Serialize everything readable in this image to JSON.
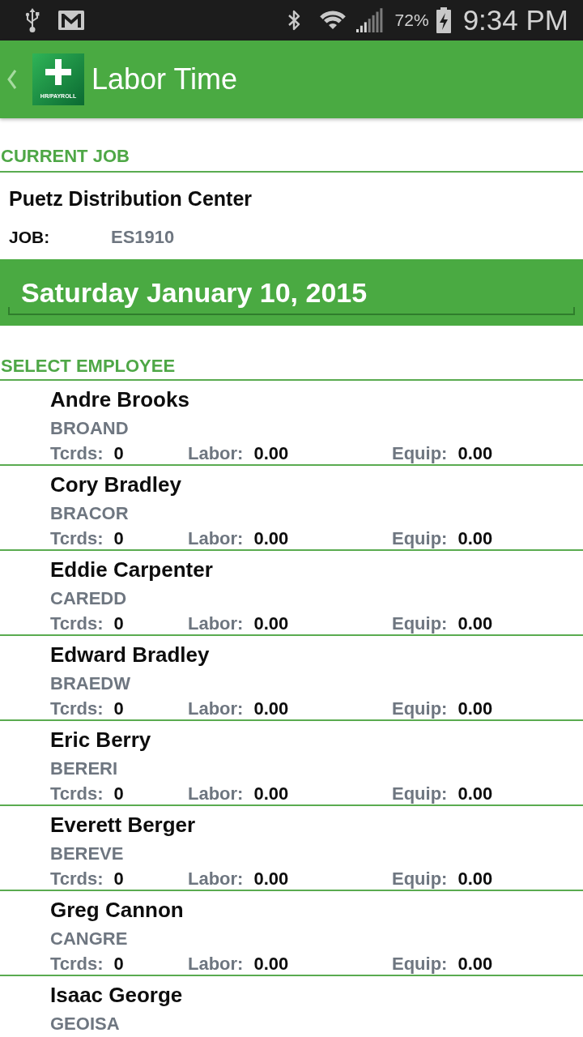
{
  "status_bar": {
    "battery": "72%",
    "time": "9:34 PM"
  },
  "app_bar": {
    "logo_caption": "HR/PAYROLL",
    "title": "Labor Time"
  },
  "current_job": {
    "heading": "CURRENT JOB",
    "name": "Puetz Distribution Center",
    "job_label": "JOB:",
    "job_number": "ES1910"
  },
  "date": "Saturday January 10, 2015",
  "employees": {
    "heading": "SELECT EMPLOYEE",
    "items": [
      {
        "name": "Andre Brooks",
        "code": "BROAND",
        "stats": [
          {
            "label": "Tcrds:",
            "value": "0"
          },
          {
            "label": "Labor:",
            "value": "0.00"
          },
          {
            "label": "Equip:",
            "value": "0.00"
          }
        ]
      },
      {
        "name": "Cory Bradley",
        "code": "BRACOR",
        "stats": [
          {
            "label": "Tcrds:",
            "value": "0"
          },
          {
            "label": "Labor:",
            "value": "0.00"
          },
          {
            "label": "Equip:",
            "value": "0.00"
          }
        ]
      },
      {
        "name": "Eddie Carpenter",
        "code": "CAREDD",
        "stats": [
          {
            "label": "Tcrds:",
            "value": "0"
          },
          {
            "label": "Labor:",
            "value": "0.00"
          },
          {
            "label": "Equip:",
            "value": "0.00"
          }
        ]
      },
      {
        "name": "Edward Bradley",
        "code": "BRAEDW",
        "stats": [
          {
            "label": "Tcrds:",
            "value": "0"
          },
          {
            "label": "Labor:",
            "value": "0.00"
          },
          {
            "label": "Equip:",
            "value": "0.00"
          }
        ]
      },
      {
        "name": "Eric Berry",
        "code": "BERERI",
        "stats": [
          {
            "label": "Tcrds:",
            "value": "0"
          },
          {
            "label": "Labor:",
            "value": "0.00"
          },
          {
            "label": "Equip:",
            "value": "0.00"
          }
        ]
      },
      {
        "name": "Everett Berger",
        "code": "BEREVE",
        "stats": [
          {
            "label": "Tcrds:",
            "value": "0"
          },
          {
            "label": "Labor:",
            "value": "0.00"
          },
          {
            "label": "Equip:",
            "value": "0.00"
          }
        ]
      },
      {
        "name": "Greg Cannon",
        "code": "CANGRE",
        "stats": [
          {
            "label": "Tcrds:",
            "value": "0"
          },
          {
            "label": "Labor:",
            "value": "0.00"
          },
          {
            "label": "Equip:",
            "value": "0.00"
          }
        ]
      },
      {
        "name": "Isaac George",
        "code": "GEOISA"
      }
    ]
  }
}
